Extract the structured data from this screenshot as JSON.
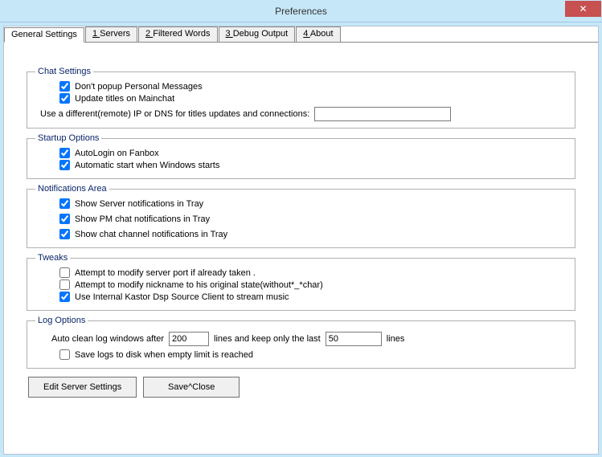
{
  "window": {
    "title": "Preferences",
    "close_glyph": "✕"
  },
  "tabs": [
    {
      "label": "General Settings",
      "prefix": ""
    },
    {
      "label": "Servers",
      "prefix": "1 "
    },
    {
      "label": "Filtered Words",
      "prefix": "2 "
    },
    {
      "label": "Debug Output",
      "prefix": "3 "
    },
    {
      "label": "About",
      "prefix": "4 "
    }
  ],
  "chat": {
    "legend": "Chat Settings",
    "opt1": "Don't popup Personal Messages",
    "opt1_checked": true,
    "opt2": "Update titles on Mainchat",
    "opt2_checked": true,
    "ip_label": "Use a different(remote) IP or DNS  for titles updates and connections:",
    "ip_value": ""
  },
  "startup": {
    "legend": "Startup Options",
    "opt1": "AutoLogin on Fanbox",
    "opt1_checked": true,
    "opt2": "Automatic start when Windows starts",
    "opt2_checked": true
  },
  "notif": {
    "legend": "Notifications Area",
    "opt1": "Show Server notifications in Tray",
    "opt1_checked": true,
    "opt2": "Show PM chat notifications in Tray",
    "opt2_checked": true,
    "opt3": "Show chat channel notifications in Tray",
    "opt3_checked": true
  },
  "tweaks": {
    "legend": "Tweaks",
    "opt1": "Attempt to modify server  port if already taken .",
    "opt1_checked": false,
    "opt2": "Attempt to modify nickname to his original  state(without*_*char)",
    "opt2_checked": false,
    "opt3": "Use Internal Kastor Dsp Source Client to stream music",
    "opt3_checked": true
  },
  "log": {
    "legend": "Log Options",
    "pre": "Auto clean log windows after",
    "val1": "200",
    "mid": "lines  and keep only the last",
    "val2": "50",
    "post": "lines",
    "save_opt": "Save logs to disk when empty limit is reached",
    "save_checked": false
  },
  "buttons": {
    "edit": "Edit Server Settings",
    "save": "Save^Close"
  }
}
